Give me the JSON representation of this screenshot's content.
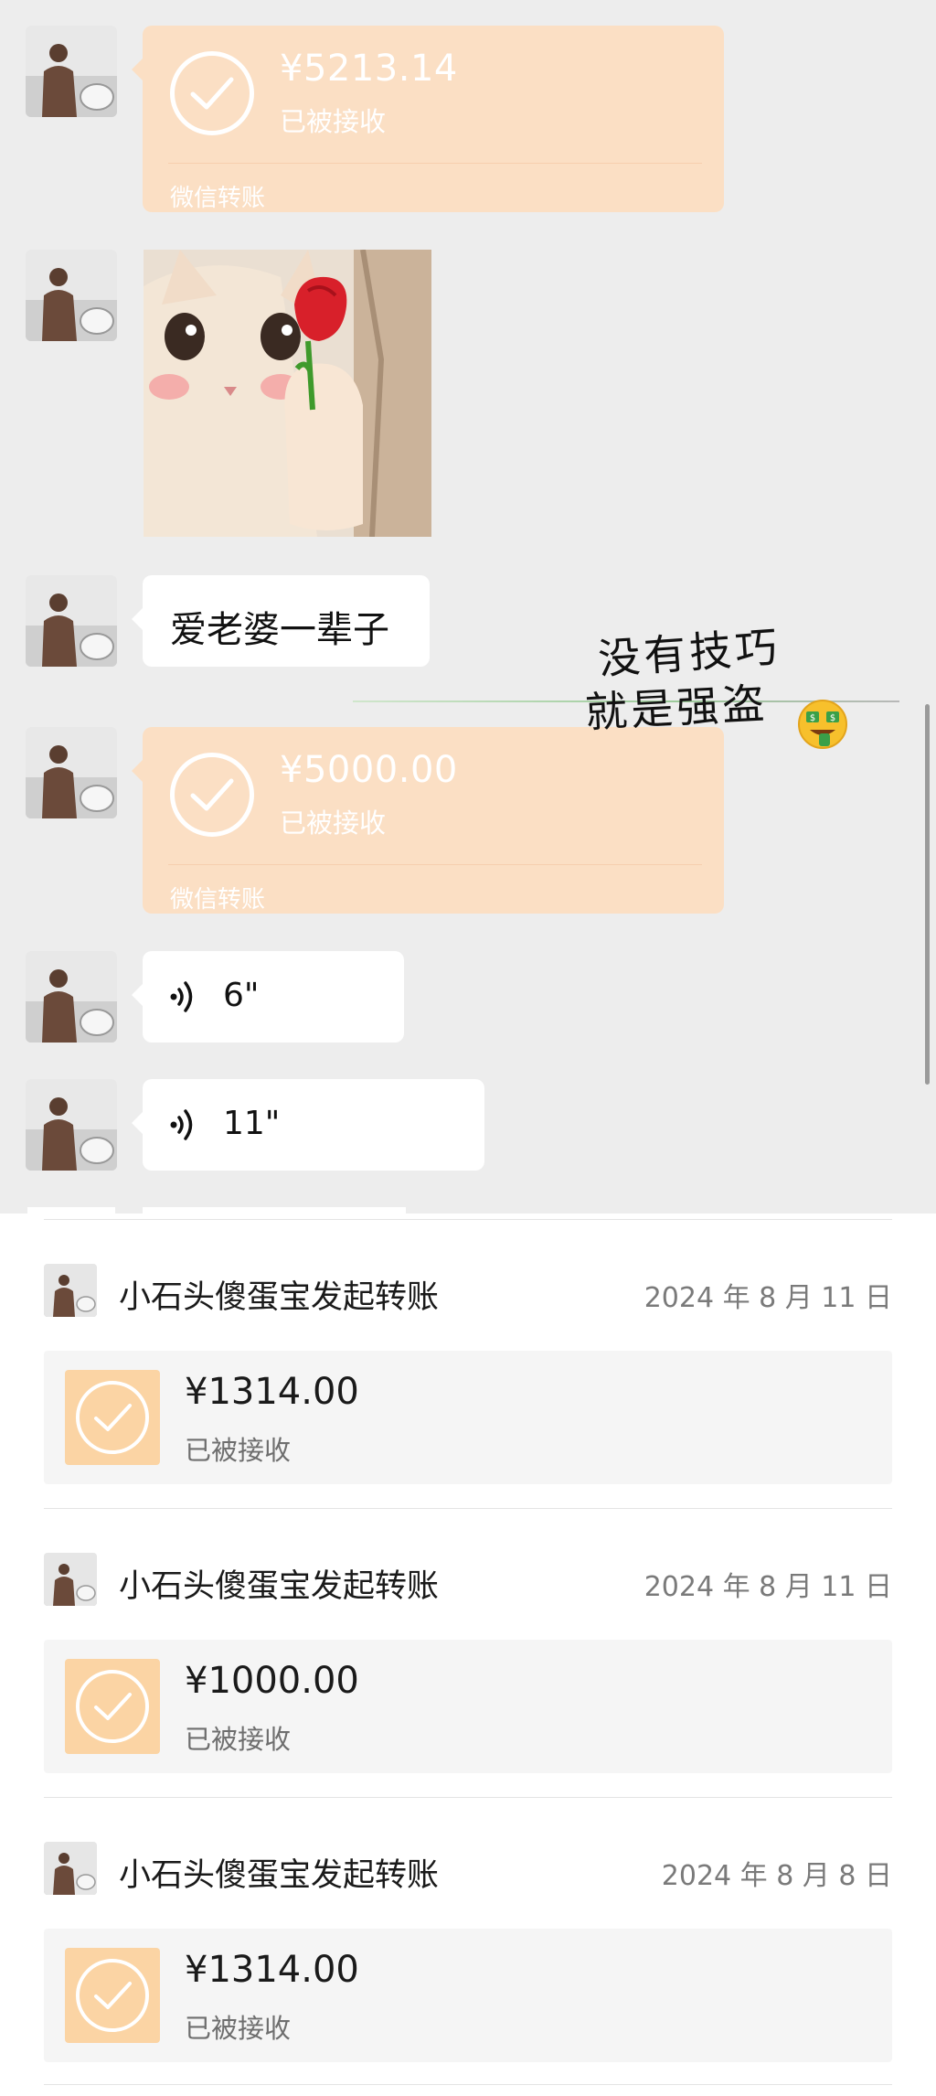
{
  "chat": {
    "transfer_1": {
      "amount": "¥5213.14",
      "status": "已被接收",
      "footer": "微信转账"
    },
    "text_message": "爱老婆一辈子",
    "transfer_2": {
      "amount": "¥5000.00",
      "status": "已被接收",
      "footer": "微信转账"
    },
    "voice_messages": [
      {
        "duration": "6\""
      },
      {
        "duration": "11\""
      }
    ],
    "overlay_caption": {
      "line1": "没有技巧",
      "line2": "就是强盗"
    }
  },
  "records": [
    {
      "title": "小石头傻蛋宝发起转账",
      "date": "2024 年 8 月 11 日",
      "amount": "¥1314.00",
      "status": "已被接收"
    },
    {
      "title": "小石头傻蛋宝发起转账",
      "date": "2024 年 8 月 11 日",
      "amount": "¥1000.00",
      "status": "已被接收"
    },
    {
      "title": "小石头傻蛋宝发起转账",
      "date": "2024 年 8 月 8 日",
      "amount": "¥1314.00",
      "status": "已被接收"
    }
  ],
  "colors": {
    "chat_background": "#ededed",
    "transfer_bubble": "#fbdfc4",
    "record_icon": "#fbd4a4",
    "record_card": "#f5f5f5"
  },
  "icons": {
    "transfer_status": "check-circle-icon",
    "voice": "voice-wave-icon",
    "emoji": "money-mouth-face-icon"
  }
}
